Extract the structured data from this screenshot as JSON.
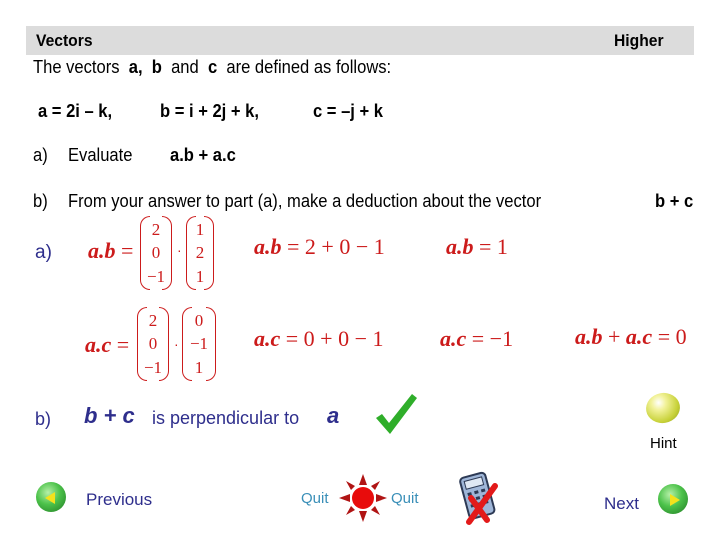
{
  "header": {
    "title": "Vectors",
    "level": "Higher"
  },
  "question": {
    "intro_prefix": "The vectors",
    "intro_a": "a,",
    "intro_b": "b",
    "intro_and": "and",
    "intro_c": "c",
    "intro_suffix": "are defined as follows:",
    "def_a": "a = 2i – k,",
    "def_b": "b = i + 2j + k,",
    "def_c": "c = –j + k",
    "part_a_label": "a)",
    "part_a_text": "Evaluate",
    "part_a_expr": "a.b + a.c",
    "part_b_label": "b)",
    "part_b_text": "From your answer to part (a), make a deduction about the vector",
    "part_b_expr": "b + c"
  },
  "solution": {
    "part_a_label": "a)",
    "ab_lhs": "a.b",
    "ab_vec1": [
      "2",
      "0",
      "−1"
    ],
    "ab_vec2": [
      "1",
      "2",
      "1"
    ],
    "ab_step_lhs": "a.b",
    "ab_step_rhs": "= 2 + 0 − 1",
    "ab_result_lhs": "a.b",
    "ab_result_rhs": "= 1",
    "ac_lhs": "a.c",
    "ac_vec1": [
      "2",
      "0",
      "−1"
    ],
    "ac_vec2": [
      "0",
      "−1",
      "1"
    ],
    "ac_step_lhs": "a.c",
    "ac_step_rhs": "= 0 + 0 − 1",
    "ac_result_lhs": "a.c",
    "ac_result_rhs": "= −1",
    "sum_lhs_1": "a.b",
    "sum_plus": "+",
    "sum_lhs_2": "a.c",
    "sum_rhs": "= 0",
    "part_b_label": "b)",
    "part_b_expr": "b + c",
    "part_b_text": "is perpendicular to",
    "part_b_vec": "a"
  },
  "controls": {
    "hint_label": "Hint",
    "previous_label": "Previous",
    "quit_label_left": "Quit",
    "quit_label_right": "Quit",
    "next_label": "Next"
  },
  "colors": {
    "header_bg": "#dcdcdc",
    "math_red": "#cc1b1b",
    "label_blue": "#2e2e8c",
    "quit_blue": "#3a8fb8",
    "check_green": "#2fae2a"
  }
}
